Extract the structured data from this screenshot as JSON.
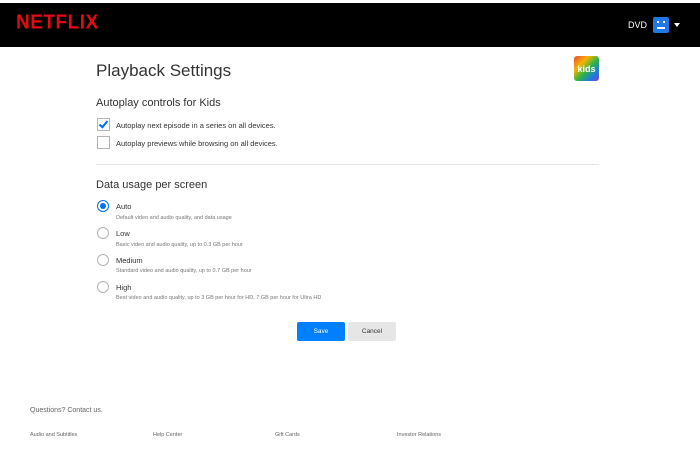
{
  "header": {
    "logo": "NETFLIX",
    "profile_name": "DVD"
  },
  "page": {
    "title": "Playback Settings",
    "kids_badge": "kids"
  },
  "autoplay": {
    "heading": "Autoplay controls for Kids",
    "options": [
      {
        "label": "Autoplay next episode in a series on all devices.",
        "checked": true
      },
      {
        "label": "Autoplay previews while browsing on all devices.",
        "checked": false
      }
    ]
  },
  "data_usage": {
    "heading": "Data usage per screen",
    "options": [
      {
        "label": "Auto",
        "desc": "Default video and audio quality, and data usage",
        "selected": true
      },
      {
        "label": "Low",
        "desc": "Basic video and audio quality, up to 0.3 GB per hour",
        "selected": false
      },
      {
        "label": "Medium",
        "desc": "Standard video and audio quality, up to 0.7 GB per hour",
        "selected": false
      },
      {
        "label": "High",
        "desc": "Best video and audio quality, up to 3 GB per hour for HD, 7 GB per hour for Ultra HD",
        "selected": false
      }
    ]
  },
  "actions": {
    "save": "Save",
    "cancel": "Cancel"
  },
  "footer": {
    "contact": "Questions? Contact us.",
    "links": [
      "Audio and Subtitles",
      "Help Center",
      "Gift Cards",
      "Investor Relations"
    ]
  },
  "colors": {
    "brand": "#e50914",
    "accent": "#0071eb",
    "save_button": "#0080ff"
  }
}
